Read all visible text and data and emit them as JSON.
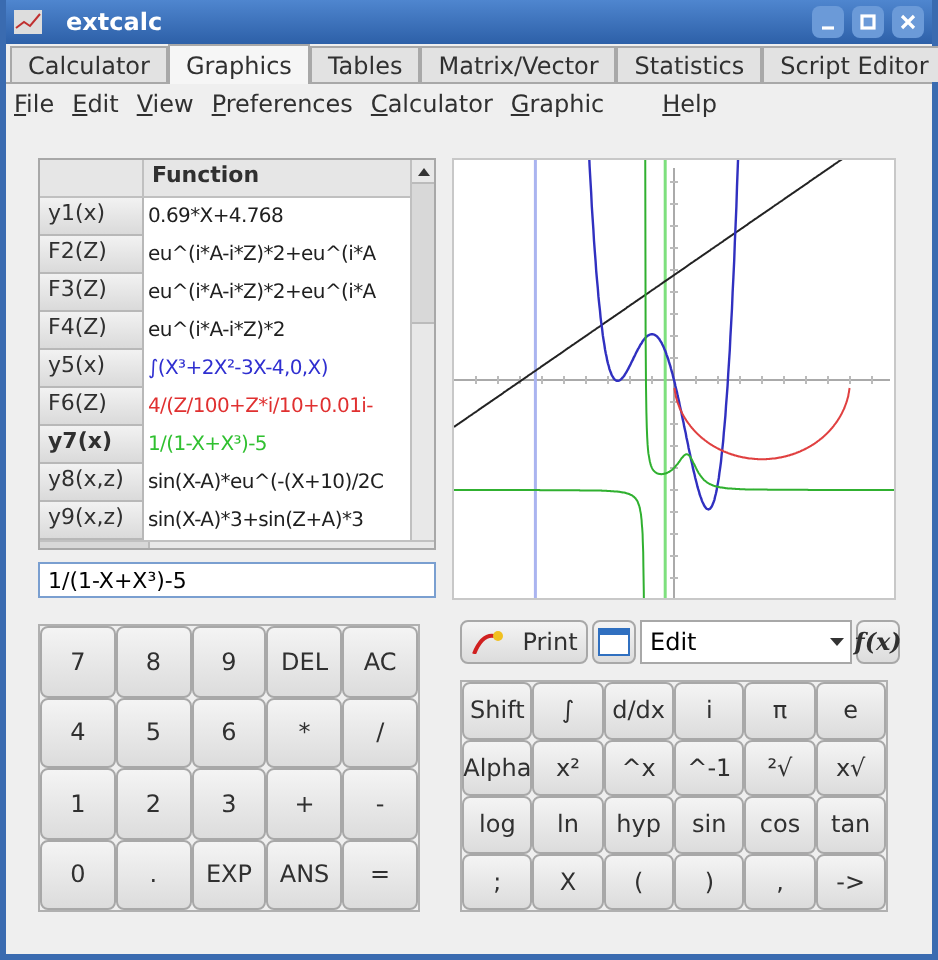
{
  "window": {
    "title": "extcalc"
  },
  "tabs": [
    {
      "label": "Calculator",
      "selected": false
    },
    {
      "label": "Graphics",
      "selected": true
    },
    {
      "label": "Tables",
      "selected": false
    },
    {
      "label": "Matrix/Vector",
      "selected": false
    },
    {
      "label": "Statistics",
      "selected": false
    },
    {
      "label": "Script Editor",
      "selected": false
    }
  ],
  "menu": [
    "File",
    "Edit",
    "View",
    "Preferences",
    "Calculator",
    "Graphic",
    "Help"
  ],
  "table": {
    "columns": [
      "Function"
    ],
    "rows": [
      {
        "name": "y1(x)",
        "function": "0.69*X+4.768",
        "color": "#202020",
        "selected": false
      },
      {
        "name": "F2(Z)",
        "function": "eu^(i*A-i*Z)*2+eu^(i*A",
        "color": "#202020",
        "selected": false
      },
      {
        "name": "F3(Z)",
        "function": "eu^(i*A-i*Z)*2+eu^(i*A",
        "color": "#202020",
        "selected": false
      },
      {
        "name": "F4(Z)",
        "function": "eu^(i*A-i*Z)*2",
        "color": "#202020",
        "selected": false
      },
      {
        "name": "y5(x)",
        "function": "∫(X³+2X²-3X-4,0,X)",
        "color": "#2f2fd0",
        "selected": false
      },
      {
        "name": "F6(Z)",
        "function": "4/(Z/100+Z*i/10+0.01i-",
        "color": "#e03030",
        "selected": false
      },
      {
        "name": "y7(x)",
        "function": "1/(1-X+X³)-5",
        "color": "#30c030",
        "selected": true
      },
      {
        "name": "y8(x,z)",
        "function": "sin(X-A)*eu^(-(X+10)/2C",
        "color": "#202020",
        "selected": false
      },
      {
        "name": "y9(x,z)",
        "function": "sin(X-A)*3+sin(Z+A)*3",
        "color": "#202020",
        "selected": false
      }
    ]
  },
  "input": {
    "value": "1/(1-X+X³)-5"
  },
  "toolbar": {
    "print": "Print",
    "mode": "Edit",
    "function_button": "f(x)"
  },
  "keypad": [
    [
      "7",
      "8",
      "9",
      "DEL",
      "AC"
    ],
    [
      "4",
      "5",
      "6",
      "*",
      "/"
    ],
    [
      "1",
      "2",
      "3",
      "+",
      "-"
    ],
    [
      "0",
      ".",
      "EXP",
      "ANS",
      "="
    ]
  ],
  "function_keypad": [
    [
      "Shift",
      "∫",
      "d/dx",
      "i",
      "π",
      "e"
    ],
    [
      "Alpha",
      "x²",
      "^x",
      "^-1",
      "²√",
      "x√"
    ],
    [
      "log",
      "ln",
      "hyp",
      "sin",
      "cos",
      "tan"
    ],
    [
      ";",
      "X",
      "(",
      ")",
      ",",
      "->"
    ]
  ]
}
